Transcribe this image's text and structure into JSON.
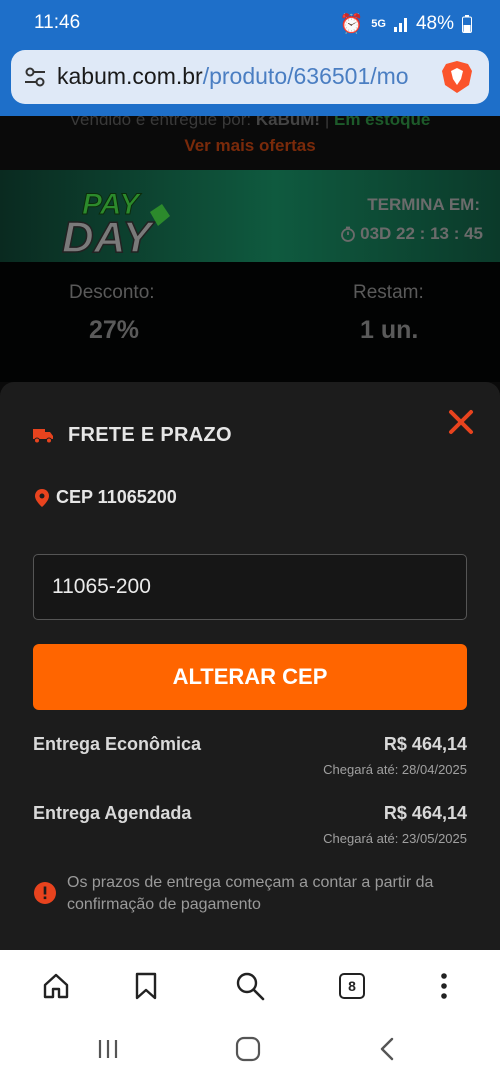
{
  "status_bar": {
    "time": "11:46",
    "battery": "48%",
    "network": "5G"
  },
  "browser": {
    "url_domain": "kabum.com.br",
    "url_path": "/produto/636501/mo"
  },
  "product": {
    "sold_by_prefix": "Vendido e entregue por:",
    "seller": "KaBuM!",
    "separator": "|",
    "stock": "Em estoque",
    "more_offers": "Ver mais ofertas"
  },
  "promo": {
    "logo_line1": "PAY",
    "logo_line2": "DAY",
    "ends_label": "TERMINA EM:",
    "countdown": "03D 22 : 13 : 45",
    "discount_label": "Desconto:",
    "discount_value": "27%",
    "remaining_label": "Restam:",
    "remaining_value": "1 un."
  },
  "shipping_sheet": {
    "title": "FRETE E PRAZO",
    "cep_label": "CEP 11065200",
    "cep_input_value": "11065-200",
    "alter_button": "ALTERAR CEP",
    "options": [
      {
        "name": "Entrega Econômica",
        "price": "R$ 464,14",
        "eta": "Chegará até: 28/04/2025"
      },
      {
        "name": "Entrega Agendada",
        "price": "R$ 464,14",
        "eta": "Chegará até: 23/05/2025"
      }
    ],
    "notice": "Os prazos de entrega começam a contar a partir da confirmação de pagamento"
  },
  "bottom_nav": {
    "tab_count": "8"
  },
  "colors": {
    "accent": "#ff6500",
    "browser_blue": "#1e6fc9",
    "alert_red": "#e8431e"
  }
}
